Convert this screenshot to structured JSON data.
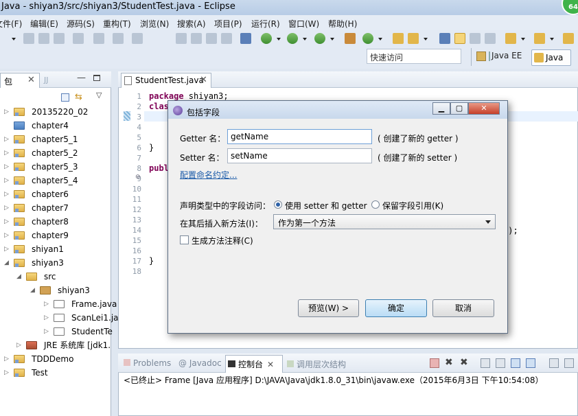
{
  "window": {
    "title": "Java  -  shiyan3/src/shiyan3/StudentTest.java  -  Eclipse",
    "badge": "64"
  },
  "menu": [
    "文件(F)",
    "编辑(E)",
    "源码(S)",
    "重构(T)",
    "浏览(N)",
    "搜索(A)",
    "项目(P)",
    "运行(R)",
    "窗口(W)",
    "帮助(H)"
  ],
  "quick_access": {
    "placeholder": "快速访问"
  },
  "perspectives": {
    "javaee": "Java EE",
    "java": "Java"
  },
  "package_explorer": {
    "tab_label": "包",
    "hierarchy_tab": "JJ",
    "items": [
      {
        "label": "20135220_02",
        "icon": "project-icon",
        "expand": "▷"
      },
      {
        "label": "chapter4",
        "icon": "folder-icon",
        "expand": ""
      },
      {
        "label": "chapter5_1",
        "icon": "project-icon",
        "expand": "▷"
      },
      {
        "label": "chapter5_2",
        "icon": "project-icon",
        "expand": "▷"
      },
      {
        "label": "chapter5_3",
        "icon": "project-icon",
        "expand": "▷"
      },
      {
        "label": "chapter5_4",
        "icon": "project-icon",
        "expand": "▷"
      },
      {
        "label": "chapter6",
        "icon": "project-icon",
        "expand": "▷"
      },
      {
        "label": "chapter7",
        "icon": "project-icon",
        "expand": "▷"
      },
      {
        "label": "chapter8",
        "icon": "project-icon",
        "expand": "▷"
      },
      {
        "label": "chapter9",
        "icon": "project-icon",
        "expand": "▷"
      },
      {
        "label": "shiyan1",
        "icon": "project-icon",
        "expand": "▷"
      },
      {
        "label": "shiyan3",
        "icon": "project-icon",
        "expand": "◢"
      },
      {
        "label": "src",
        "icon": "source-folder-icon",
        "expand": "◢"
      },
      {
        "label": "shiyan3",
        "icon": "package-icon",
        "expand": "◢"
      },
      {
        "label": "Frame.java",
        "icon": "java-file-icon",
        "expand": "▷"
      },
      {
        "label": "ScanLei1.ja",
        "icon": "java-file-icon",
        "expand": "▷"
      },
      {
        "label": "StudentTe",
        "icon": "java-file-icon",
        "expand": "▷"
      },
      {
        "label": "JRE 系统库 [jdk1.",
        "icon": "jre-library-icon",
        "expand": "▷"
      },
      {
        "label": "TDDDemo",
        "icon": "project-icon",
        "expand": "▷"
      },
      {
        "label": "Test",
        "icon": "project-icon",
        "expand": "▷"
      }
    ]
  },
  "editor": {
    "tab_label": "StudentTest.java",
    "lines": [
      {
        "n": "1",
        "kw": "package",
        "rest": " shiyan3;"
      },
      {
        "n": "2",
        "kw": "clas",
        "rest": ""
      },
      {
        "n": "3",
        "kw": "",
        "rest": ""
      },
      {
        "n": "4",
        "kw": "",
        "rest": ""
      },
      {
        "n": "5",
        "kw": "",
        "rest": ""
      },
      {
        "n": "6",
        "kw": "",
        "rest": "}"
      },
      {
        "n": "7",
        "kw": "",
        "rest": ""
      },
      {
        "n": "8",
        "kw": "publ",
        "rest": ""
      },
      {
        "n": "9",
        "kw": "",
        "rest": ""
      },
      {
        "n": "10",
        "kw": "",
        "rest": ""
      },
      {
        "n": "11",
        "kw": "",
        "rest": ""
      },
      {
        "n": "12",
        "kw": "",
        "rest": ""
      },
      {
        "n": "13",
        "kw": "",
        "rest": ""
      },
      {
        "n": "14",
        "kw": "",
        "rest": ""
      },
      {
        "n": "15",
        "kw": "",
        "rest": ""
      },
      {
        "n": "16",
        "kw": "",
        "rest": ""
      },
      {
        "n": "17",
        "kw": "",
        "rest": "}"
      },
      {
        "n": "18",
        "kw": "",
        "rest": ""
      }
    ],
    "line9_marker": "⊖",
    "line14_tail": "));"
  },
  "console": {
    "tabs": {
      "problems": "Problems",
      "javadoc": "@ Javadoc",
      "console": "控制台",
      "call_hierarchy": "调用层次结构"
    },
    "text": "<已终止> Frame [Java 应用程序] D:\\JAVA\\Java\\jdk1.8.0_31\\bin\\javaw.exe（2015年6月3日 下午10:54:08）"
  },
  "dialog": {
    "title": "包括字段",
    "getter_label": "Getter 名：",
    "getter_value": "getName",
    "getter_note": "( 创建了新的 getter )",
    "setter_label": "Setter 名：",
    "setter_value": "setName",
    "setter_note": "( 创建了新的 setter )",
    "config_link": "配置命名约定...",
    "access_label": "声明类型中的字段访问：",
    "radio_use": "使用 setter 和 getter",
    "radio_keep": "保留字段引用(K)",
    "insert_label": "在其后插入新方法(I)：",
    "insert_value": "作为第一个方法",
    "checkbox_label": "生成方法注释(C)",
    "preview_button": "预览(W) >",
    "ok_button": "确定",
    "cancel_button": "取消"
  }
}
